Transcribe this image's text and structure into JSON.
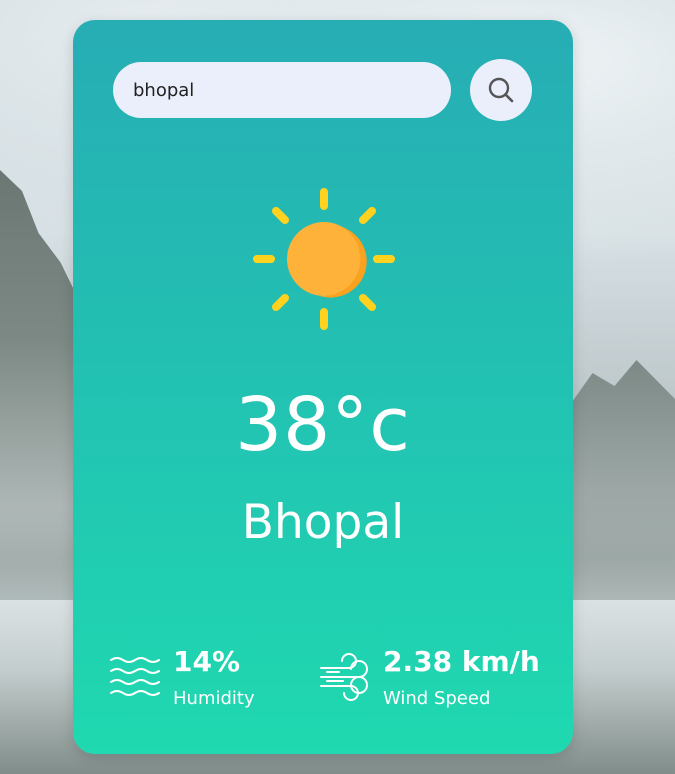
{
  "search": {
    "value": "bhopal",
    "icon": "search-icon"
  },
  "weather": {
    "icon": "sun-icon",
    "temperature": "38°c",
    "city": "Bhopal"
  },
  "details": {
    "humidity": {
      "icon": "humidity-icon",
      "value": "14%",
      "label": "Humidity"
    },
    "wind": {
      "icon": "wind-icon",
      "value": "2.38 km/h",
      "label": "Wind Speed"
    }
  },
  "colors": {
    "card_top": "#27adb4",
    "card_bottom": "#1fd9b0",
    "input_bg": "#ebeffb",
    "sun_core": "#ffb23a",
    "sun_rays": "#ffd21f"
  }
}
